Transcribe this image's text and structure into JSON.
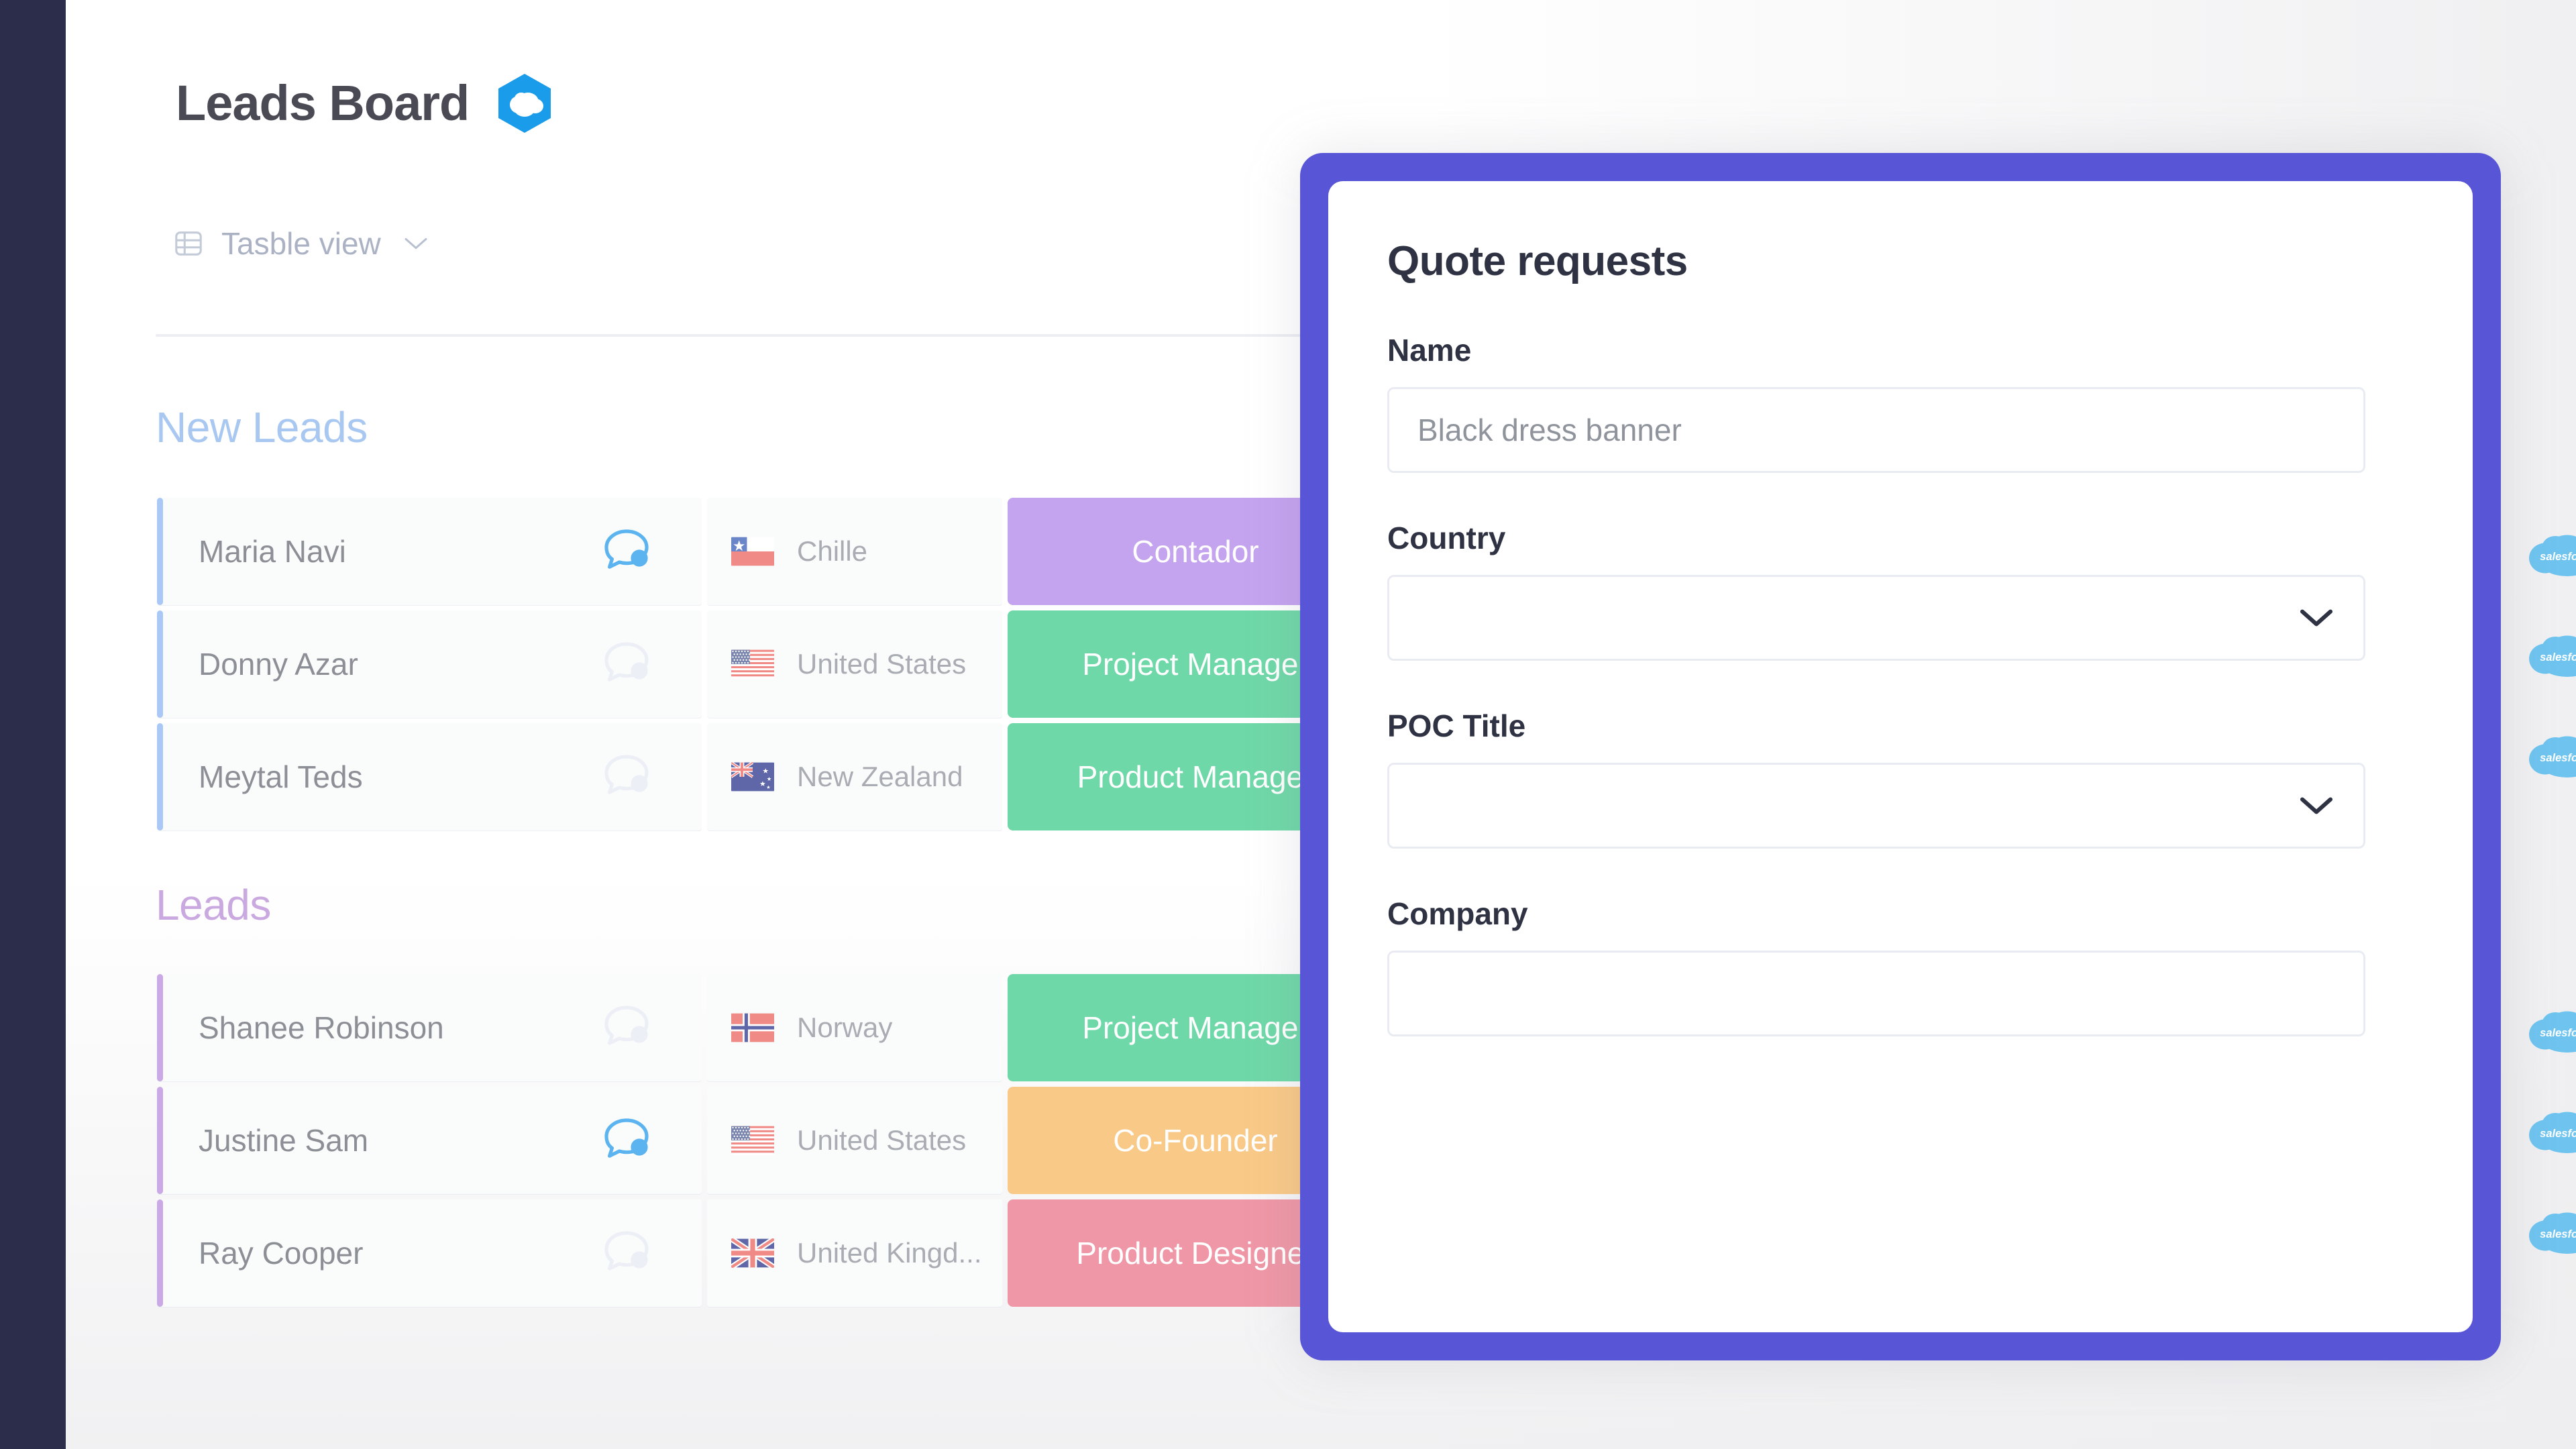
{
  "header": {
    "title": "Leads Board",
    "logo_icon": "salesforce-cloud-hexagon-icon"
  },
  "view_switch": {
    "label": "Tasble view",
    "table_icon": "table-grid-icon",
    "chevron_icon": "chevron-down-icon"
  },
  "board": {
    "sections": [
      {
        "title": "New Leads",
        "accent_color": "#a8c8f2",
        "row_accent": "#a9c8f5",
        "rows": [
          {
            "name": "Maria Navi",
            "chat_icon": "chat-bubble-icon",
            "chat_active": true,
            "country": "Chille",
            "flag": "cl",
            "role": "Contador",
            "role_color": "#c4a3ef",
            "sf_icon": "salesforce-cloud-icon"
          },
          {
            "name": "Donny Azar",
            "chat_icon": "chat-bubble-icon",
            "chat_active": false,
            "country": "United States",
            "flag": "us",
            "role": "Project Manager",
            "role_color": "#6fd8a8",
            "sf_icon": "salesforce-cloud-icon"
          },
          {
            "name": "Meytal Teds",
            "chat_icon": "chat-bubble-icon",
            "chat_active": false,
            "country": "New Zealand",
            "flag": "nz",
            "role": "Product Manager",
            "role_color": "#6fd8a8",
            "sf_icon": "salesforce-cloud-icon"
          }
        ]
      },
      {
        "title": "Leads",
        "accent_color": "#caa9e0",
        "row_accent": "#cba8e6",
        "rows": [
          {
            "name": "Shanee Robinson",
            "chat_icon": "chat-bubble-icon",
            "chat_active": false,
            "country": "Norway",
            "flag": "no",
            "role": "Project Manager",
            "role_color": "#6fd8a8",
            "sf_icon": "salesforce-cloud-icon"
          },
          {
            "name": "Justine Sam",
            "chat_icon": "chat-bubble-icon",
            "chat_active": true,
            "country": "United States",
            "flag": "us",
            "role": "Co-Founder",
            "role_color": "#f9c987",
            "sf_icon": "salesforce-cloud-icon"
          },
          {
            "name": "Ray Cooper",
            "chat_icon": "chat-bubble-icon",
            "chat_active": false,
            "country": "United Kingd...",
            "flag": "gb",
            "role": "Product Designer",
            "role_color": "#ef97a6",
            "sf_icon": "salesforce-cloud-icon"
          }
        ]
      }
    ]
  },
  "modal": {
    "title": "Quote requests",
    "border_color": "#5856d6",
    "fields": [
      {
        "label": "Name",
        "type": "text",
        "value": "Black dress banner"
      },
      {
        "label": "Country",
        "type": "select",
        "value": ""
      },
      {
        "label": "POC Title",
        "type": "select",
        "value": ""
      },
      {
        "label": "Company",
        "type": "text",
        "value": ""
      }
    ],
    "chevron_icon": "chevron-down-icon"
  },
  "right_column": {
    "sf_icon": "salesforce-cloud-icon",
    "count": 6
  }
}
